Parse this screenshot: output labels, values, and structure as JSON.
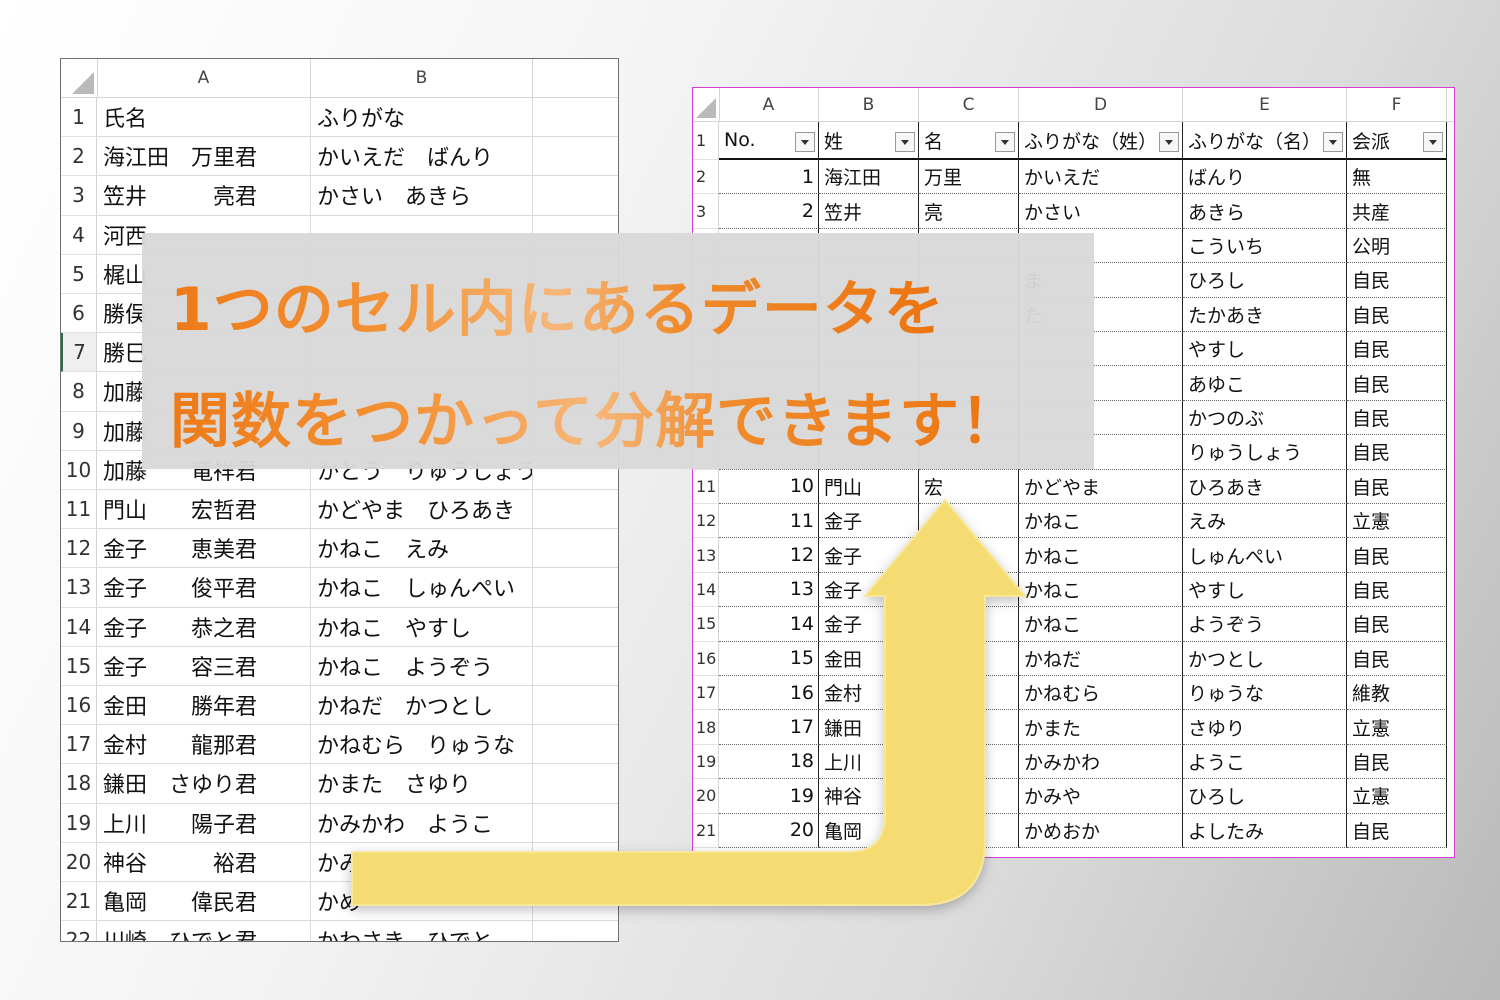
{
  "left_sheet": {
    "columns": [
      "A",
      "B"
    ],
    "rows": [
      {
        "num": "1",
        "a": "氏名",
        "b": "ふりがな"
      },
      {
        "num": "2",
        "a": "海江田　万里君",
        "b": "かいえだ　ばんり"
      },
      {
        "num": "3",
        "a": "笠井　　　亮君",
        "b": "かさい　あきら"
      },
      {
        "num": "4",
        "a": "河西",
        "b": ""
      },
      {
        "num": "5",
        "a": "梶山",
        "b": ""
      },
      {
        "num": "6",
        "a": "勝俣",
        "b": ""
      },
      {
        "num": "7",
        "a": "勝巳",
        "b": ""
      },
      {
        "num": "8",
        "a": "加藤",
        "b": ""
      },
      {
        "num": "9",
        "a": "加藤",
        "b": ""
      },
      {
        "num": "10",
        "a": "加藤　　竜祥君",
        "b": "かとう　りゅうしょう"
      },
      {
        "num": "11",
        "a": "門山　　宏哲君",
        "b": "かどやま　ひろあき"
      },
      {
        "num": "12",
        "a": "金子　　恵美君",
        "b": "かねこ　えみ"
      },
      {
        "num": "13",
        "a": "金子　　俊平君",
        "b": "かねこ　しゅんぺい"
      },
      {
        "num": "14",
        "a": "金子　　恭之君",
        "b": "かねこ　やすし"
      },
      {
        "num": "15",
        "a": "金子　　容三君",
        "b": "かねこ　ようぞう"
      },
      {
        "num": "16",
        "a": "金田　　勝年君",
        "b": "かねだ　かつとし"
      },
      {
        "num": "17",
        "a": "金村　　龍那君",
        "b": "かねむら　りゅうな"
      },
      {
        "num": "18",
        "a": "鎌田　さゆり君",
        "b": "かまた　さゆり"
      },
      {
        "num": "19",
        "a": "上川　　陽子君",
        "b": "かみかわ　ようこ"
      },
      {
        "num": "20",
        "a": "神谷　　　裕君",
        "b": "かみ"
      },
      {
        "num": "21",
        "a": "亀岡　　偉民君",
        "b": "かめ"
      },
      {
        "num": "22",
        "a": "川崎　ひでと君",
        "b": "かわさき　ひでと"
      }
    ],
    "selected_row": "7"
  },
  "right_sheet": {
    "columns": [
      "A",
      "B",
      "C",
      "D",
      "E",
      "F"
    ],
    "header": {
      "num": "1",
      "cells": [
        "No.",
        "姓",
        "名",
        "ふりがな（姓）",
        "ふりがな（名）",
        "会派"
      ]
    },
    "rows": [
      {
        "num": "2",
        "cells": [
          "1",
          "海江田",
          "万里",
          "かいえだ",
          "ばんり",
          "無"
        ]
      },
      {
        "num": "3",
        "cells": [
          "2",
          "笠井",
          "亮",
          "かさい",
          "あきら",
          "共産"
        ]
      },
      {
        "num": "",
        "cells": [
          "",
          "",
          "",
          "",
          "こういち",
          "公明"
        ]
      },
      {
        "num": "",
        "cells": [
          "",
          "",
          "",
          "ま",
          "ひろし",
          "自民"
        ]
      },
      {
        "num": "",
        "cells": [
          "",
          "",
          "",
          "た",
          "たかあき",
          "自民"
        ]
      },
      {
        "num": "",
        "cells": [
          "",
          "",
          "",
          "",
          "やすし",
          "自民"
        ]
      },
      {
        "num": "",
        "cells": [
          "",
          "",
          "",
          "",
          "あゆこ",
          "自民"
        ]
      },
      {
        "num": "",
        "cells": [
          "",
          "",
          "",
          "",
          "かつのぶ",
          "自民"
        ]
      },
      {
        "num": "",
        "cells": [
          "",
          "",
          "",
          "",
          "りゅうしょう",
          "自民"
        ]
      },
      {
        "num": "11",
        "cells": [
          "10",
          "門山",
          "宏",
          "かどやま",
          "ひろあき",
          "自民"
        ]
      },
      {
        "num": "12",
        "cells": [
          "11",
          "金子",
          "",
          "かねこ",
          "えみ",
          "立憲"
        ]
      },
      {
        "num": "13",
        "cells": [
          "12",
          "金子",
          "",
          "かねこ",
          "しゅんぺい",
          "自民"
        ]
      },
      {
        "num": "14",
        "cells": [
          "13",
          "金子",
          "",
          "かねこ",
          "やすし",
          "自民"
        ]
      },
      {
        "num": "15",
        "cells": [
          "14",
          "金子",
          "",
          "かねこ",
          "ようぞう",
          "自民"
        ]
      },
      {
        "num": "16",
        "cells": [
          "15",
          "金田",
          "",
          "かねだ",
          "かつとし",
          "自民"
        ]
      },
      {
        "num": "17",
        "cells": [
          "16",
          "金村",
          "",
          "かねむら",
          "りゅうな",
          "維教"
        ]
      },
      {
        "num": "18",
        "cells": [
          "17",
          "鎌田",
          "",
          "かまた",
          "さゆり",
          "立憲"
        ]
      },
      {
        "num": "19",
        "cells": [
          "18",
          "上川",
          "",
          "かみかわ",
          "ようこ",
          "自民"
        ]
      },
      {
        "num": "20",
        "cells": [
          "19",
          "神谷",
          "",
          "かみや",
          "ひろし",
          "立憲"
        ]
      },
      {
        "num": "21",
        "cells": [
          "20",
          "亀岡",
          "",
          "かめおか",
          "よしたみ",
          "自民"
        ]
      }
    ]
  },
  "banner": {
    "line1": "1つのセル内にあるデータを",
    "line2": "関数をつかって分解できます！"
  },
  "colors": {
    "banner_text": "#ee7a18",
    "banner_bg": "#d8d8d8",
    "arrow_fill": "#f5dc72",
    "sheet_selection": "#d63bd6"
  }
}
